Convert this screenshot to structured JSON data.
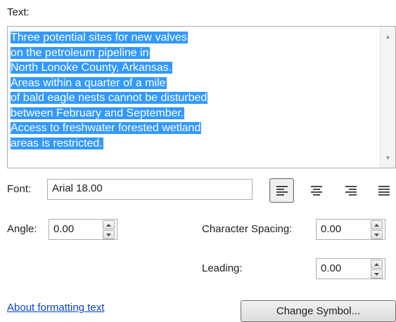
{
  "text_section": {
    "label": "Text:",
    "lines": [
      "Three potential sites for new valves",
      "on the petroleum pipeline in",
      "North Lonoke County, Arkansas.",
      "Areas within a quarter of a mile",
      "of bald eagle nests cannot be disturbed",
      "between February and September.",
      "Access to freshwater forested wetland",
      "areas is restricted."
    ],
    "selection_color": "#3399ff"
  },
  "font": {
    "label": "Font:",
    "value": "Arial 18.00"
  },
  "alignment": {
    "options": [
      "align-left",
      "align-center",
      "align-right",
      "justify"
    ],
    "selected": "align-left"
  },
  "angle": {
    "label": "Angle:",
    "value": "0.00"
  },
  "character_spacing": {
    "label": "Character Spacing:",
    "value": "0.00"
  },
  "leading": {
    "label": "Leading:",
    "value": "0.00"
  },
  "help_link": {
    "text": "About formatting text"
  },
  "change_symbol_button": {
    "label": "Change Symbol..."
  }
}
